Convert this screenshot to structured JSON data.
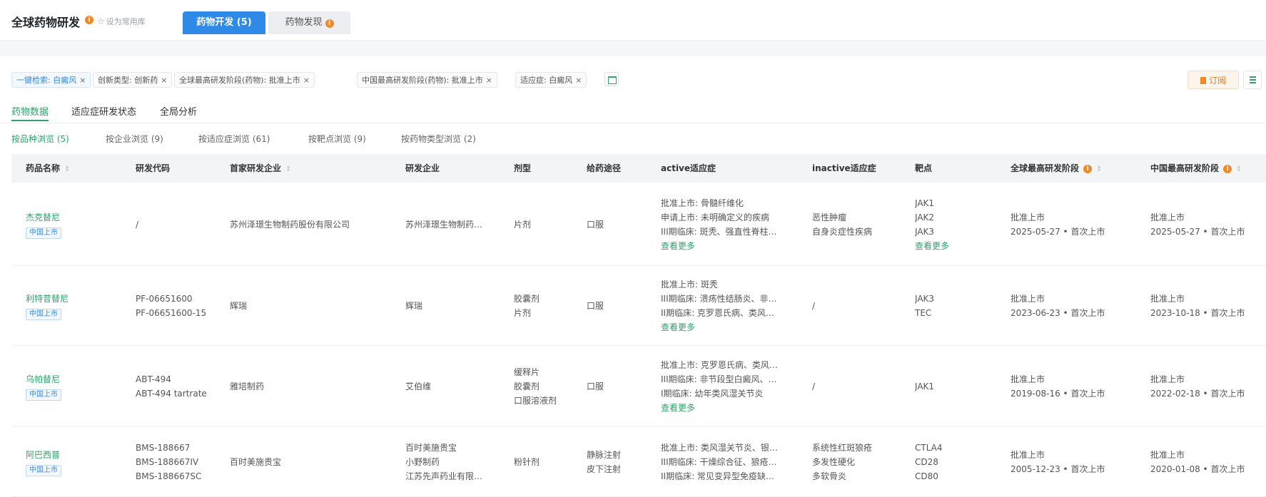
{
  "header": {
    "title": "全球药物研发",
    "info_icon": "i",
    "favorite_label": "设为常用库",
    "tabs": [
      {
        "label": "药物开发 (5)",
        "active": true
      },
      {
        "label": "药物发现",
        "active": false
      }
    ]
  },
  "filters": {
    "chips": [
      "一键检索: 白癜风",
      "创新类型: 创新药",
      "全球最高研发阶段(药物): 批准上市",
      "中国最高研发阶段(药物): 批准上市",
      "适应症: 白癜风"
    ],
    "remove_glyph": "×"
  },
  "toolbar": {
    "subscribe_label": "订阅"
  },
  "subtabs": [
    "药物数据",
    "适应症研发状态",
    "全局分析"
  ],
  "browse_tabs": [
    "按品种浏览 (5)",
    "按企业浏览 (9)",
    "按适应症浏览 (61)",
    "按靶点浏览 (9)",
    "按药物类型浏览 (2)"
  ],
  "table": {
    "columns": [
      {
        "label": "药品名称",
        "sortable": true
      },
      {
        "label": "研发代码"
      },
      {
        "label": "首家研发企业",
        "sortable": true
      },
      {
        "label": "研发企业"
      },
      {
        "label": "剂型"
      },
      {
        "label": "给药途径"
      },
      {
        "label": "active适应症"
      },
      {
        "label": "inactive适应症"
      },
      {
        "label": "靶点"
      },
      {
        "label": "全球最高研发阶段",
        "info": true,
        "sortable": true
      },
      {
        "label": "中国最高研发阶段",
        "info": true,
        "sortable": true
      }
    ],
    "sort_glyph": "⇕",
    "rows": [
      {
        "name": "杰克替尼",
        "badge": "中国上市",
        "codes": [
          "/"
        ],
        "first_company": "苏州泽璟生物制药股份有限公司",
        "companies": [
          "苏州泽璟生物制药…"
        ],
        "forms": [
          "片剂"
        ],
        "routes": [
          "口服"
        ],
        "active": [
          "批准上市: 骨髓纤维化",
          "申请上市: 未明确定义的疾病",
          "III期临床: 斑秃、强直性脊柱…",
          "查看更多"
        ],
        "inactive": [
          "恶性肿瘤",
          "自身炎症性疾病"
        ],
        "targets": [
          "JAK1",
          "JAK2",
          "JAK3",
          "查看更多"
        ],
        "global_stage": [
          "批准上市",
          "2025-05-27 • 首次上市"
        ],
        "china_stage": [
          "批准上市",
          "2025-05-27 • 首次上市"
        ]
      },
      {
        "name": "利特昔替尼",
        "badge": "中国上市",
        "codes": [
          "PF-06651600",
          "PF-06651600-15"
        ],
        "first_company": "辉瑞",
        "companies": [
          "辉瑞"
        ],
        "forms": [
          "胶囊剂",
          "片剂"
        ],
        "routes": [
          "口服"
        ],
        "active": [
          "批准上市: 斑秃",
          "III期临床: 溃疡性结肠炎、非…",
          "II期临床: 克罗恩氏病、类风…",
          "查看更多"
        ],
        "inactive": [
          "/"
        ],
        "targets": [
          "JAK3",
          "TEC"
        ],
        "global_stage": [
          "批准上市",
          "2023-06-23 • 首次上市"
        ],
        "china_stage": [
          "批准上市",
          "2023-10-18 • 首次上市"
        ]
      },
      {
        "name": "乌帕替尼",
        "badge": "中国上市",
        "codes": [
          "ABT-494",
          "ABT-494 tartrate"
        ],
        "first_company": "雅培制药",
        "companies": [
          "艾伯维"
        ],
        "forms": [
          "缓释片",
          "胶囊剂",
          "口服溶液剂"
        ],
        "routes": [
          "口服"
        ],
        "active": [
          "批准上市: 克罗恩氏病、类风…",
          "III期临床: 非节段型白癜风、…",
          "I期临床: 幼年类风湿关节炎",
          "查看更多"
        ],
        "inactive": [
          "/"
        ],
        "targets": [
          "JAK1"
        ],
        "global_stage": [
          "批准上市",
          "2019-08-16 • 首次上市"
        ],
        "china_stage": [
          "批准上市",
          "2022-02-18 • 首次上市"
        ]
      },
      {
        "name": "阿巴西普",
        "badge": "中国上市",
        "codes": [
          "BMS-188667",
          "BMS-188667IV",
          "BMS-188667SC"
        ],
        "first_company": "百时美施贵宝",
        "companies": [
          "百时美施贵宝",
          "小野制药",
          "江苏先声药业有限…"
        ],
        "forms": [
          "粉针剂"
        ],
        "routes": [
          "静脉注射",
          "皮下注射"
        ],
        "active": [
          "批准上市: 类风湿关节炎、银…",
          "III期临床: 干燥综合征、狼疮…",
          "II期临床: 常见变异型免疫缺…"
        ],
        "inactive": [
          "系统性红斑狼疮",
          "多发性硬化",
          "多软骨炎"
        ],
        "targets": [
          "CTLA4",
          "CD28",
          "CD80"
        ],
        "global_stage": [
          "批准上市",
          "2005-12-23 • 首次上市"
        ],
        "china_stage": [
          "批准上市",
          "2020-01-08 • 首次上市"
        ]
      }
    ]
  }
}
